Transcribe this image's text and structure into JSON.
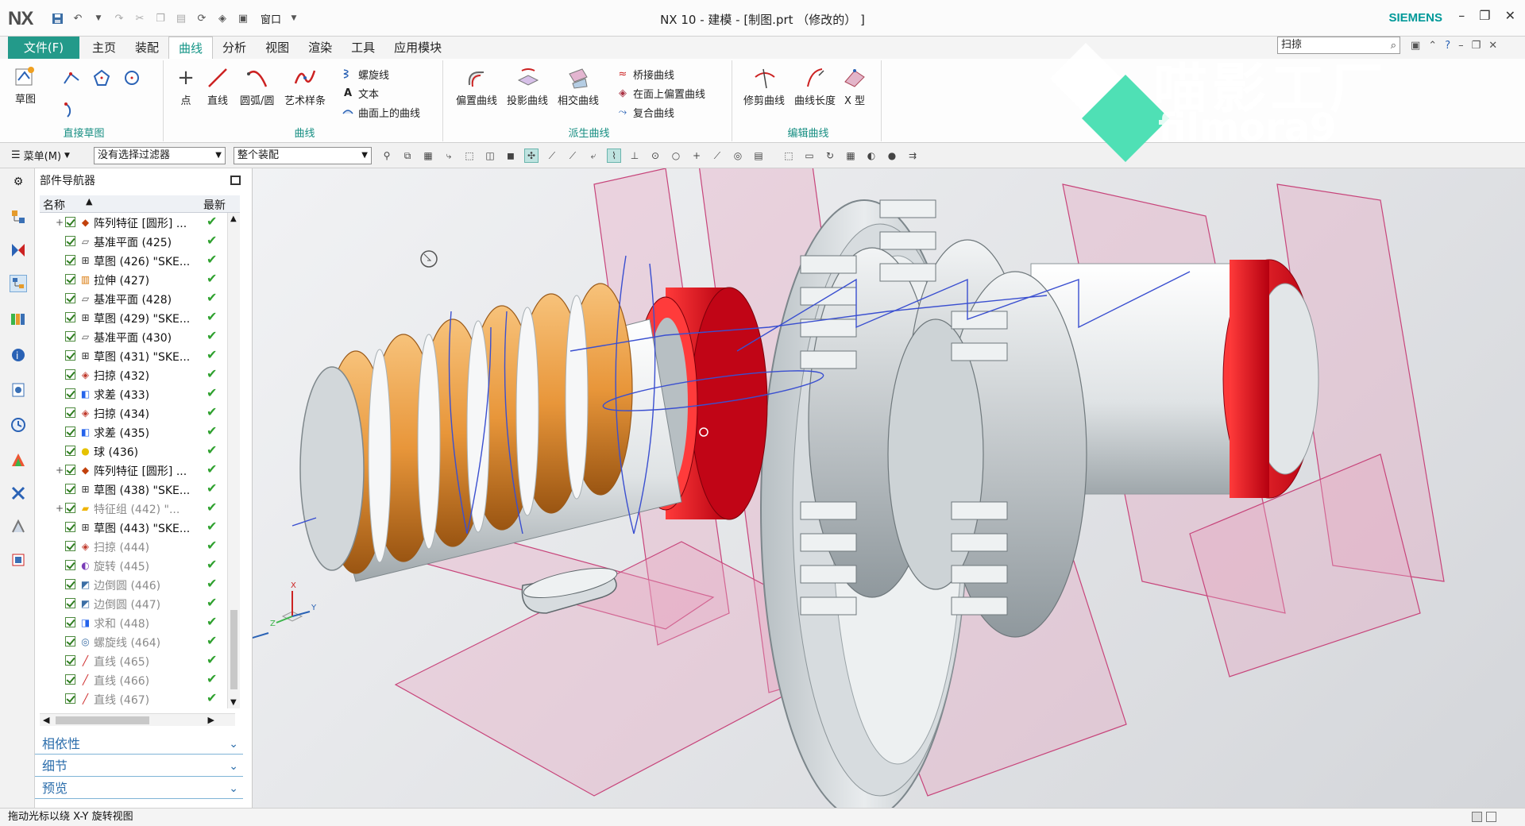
{
  "window": {
    "logo": "NX",
    "title": "NX 10 - 建模 - [制图.prt （修改的） ]",
    "brand": "SIEMENS",
    "window_menu": "窗口",
    "brand_color": "#009999"
  },
  "menubar": {
    "file": "文件(F)",
    "tabs": [
      "主页",
      "装配",
      "曲线",
      "分析",
      "视图",
      "渲染",
      "工具",
      "应用模块"
    ],
    "active_tab": "曲线",
    "search_value": "扫掠"
  },
  "ribbon": {
    "sketch": "草图",
    "direct_sketch_group": "直接草图",
    "point": "点",
    "line": "直线",
    "arc": "圆弧/圆",
    "studio_spline": "艺术样条",
    "helix": "螺旋线",
    "text": "文本",
    "curve_on_surface": "曲面上的曲线",
    "curve_group": "曲线",
    "offset_curve": "偏置曲线",
    "project_curve": "投影曲线",
    "intersection_curve": "相交曲线",
    "bridge_curve": "桥接曲线",
    "offset_in_face": "在面上偏置曲线",
    "composite_curve": "复合曲线",
    "derived_group": "派生曲线",
    "trim_curve": "修剪曲线",
    "curve_length": "曲线长度",
    "x_form": "X 型",
    "edit_group": "编辑曲线"
  },
  "toolbar": {
    "menu": "菜单(M)",
    "filter": "没有选择过滤器",
    "scope": "整个装配"
  },
  "navigator": {
    "title": "部件导航器",
    "col_name": "名称",
    "col_latest": "最新",
    "rows": [
      {
        "label": "阵列特征 [圆形] ...",
        "icon": "pattern-icon",
        "expand": "+",
        "dim": false
      },
      {
        "label": "基准平面 (425)",
        "icon": "datum-plane-icon",
        "expand": "",
        "dim": false
      },
      {
        "label": "草图 (426) \"SKE...",
        "icon": "sketch-icon",
        "expand": "",
        "dim": false
      },
      {
        "label": "拉伸 (427)",
        "icon": "extrude-icon",
        "expand": "",
        "dim": false
      },
      {
        "label": "基准平面 (428)",
        "icon": "datum-plane-icon",
        "expand": "",
        "dim": false
      },
      {
        "label": "草图 (429) \"SKE...",
        "icon": "sketch-icon",
        "expand": "",
        "dim": false
      },
      {
        "label": "基准平面 (430)",
        "icon": "datum-plane-icon",
        "expand": "",
        "dim": false
      },
      {
        "label": "草图 (431) \"SKE...",
        "icon": "sketch-icon",
        "expand": "",
        "dim": false
      },
      {
        "label": "扫掠 (432)",
        "icon": "sweep-icon",
        "expand": "",
        "dim": false
      },
      {
        "label": "求差 (433)",
        "icon": "subtract-icon",
        "expand": "",
        "dim": false
      },
      {
        "label": "扫掠 (434)",
        "icon": "sweep-icon",
        "expand": "",
        "dim": false
      },
      {
        "label": "求差 (435)",
        "icon": "subtract-icon",
        "expand": "",
        "dim": false
      },
      {
        "label": "球 (436)",
        "icon": "sphere-icon",
        "expand": "",
        "dim": false
      },
      {
        "label": "阵列特征 [圆形] ...",
        "icon": "pattern-icon",
        "expand": "+",
        "dim": false
      },
      {
        "label": "草图 (438) \"SKE...",
        "icon": "sketch-icon",
        "expand": "",
        "dim": false
      },
      {
        "label": "特征组 (442) \"...",
        "icon": "feature-group-icon",
        "expand": "+",
        "dim": true
      },
      {
        "label": "草图 (443) \"SKE...",
        "icon": "sketch-icon",
        "expand": "",
        "dim": false
      },
      {
        "label": "扫掠 (444)",
        "icon": "sweep-icon",
        "expand": "",
        "dim": true
      },
      {
        "label": "旋转 (445)",
        "icon": "revolve-icon",
        "expand": "",
        "dim": true
      },
      {
        "label": "边倒圆 (446)",
        "icon": "edge-blend-icon",
        "expand": "",
        "dim": true
      },
      {
        "label": "边倒圆 (447)",
        "icon": "edge-blend-icon",
        "expand": "",
        "dim": true
      },
      {
        "label": "求和 (448)",
        "icon": "unite-icon",
        "expand": "",
        "dim": true
      },
      {
        "label": "螺旋线 (464)",
        "icon": "helix-icon",
        "expand": "",
        "dim": true
      },
      {
        "label": "直线 (465)",
        "icon": "line-icon",
        "expand": "",
        "dim": true
      },
      {
        "label": "直线 (466)",
        "icon": "line-icon",
        "expand": "",
        "dim": true
      },
      {
        "label": "直线 (467)",
        "icon": "line-icon",
        "expand": "",
        "dim": true
      }
    ],
    "panels": [
      "相依性",
      "细节",
      "预览"
    ]
  },
  "viewport": {
    "triad_x": "X",
    "triad_y": "Y",
    "triad_z": "Z"
  },
  "watermark": {
    "cn": "喵影工厂",
    "en": "filmora9"
  },
  "status": "拖动光标以绕 X-Y 旋转视图",
  "colors": {
    "accent": "#239a8a",
    "red_part": "#e20e1a",
    "thread": "#e89a3c",
    "plane": "#e27fa6",
    "curve": "#3a4fd0"
  }
}
